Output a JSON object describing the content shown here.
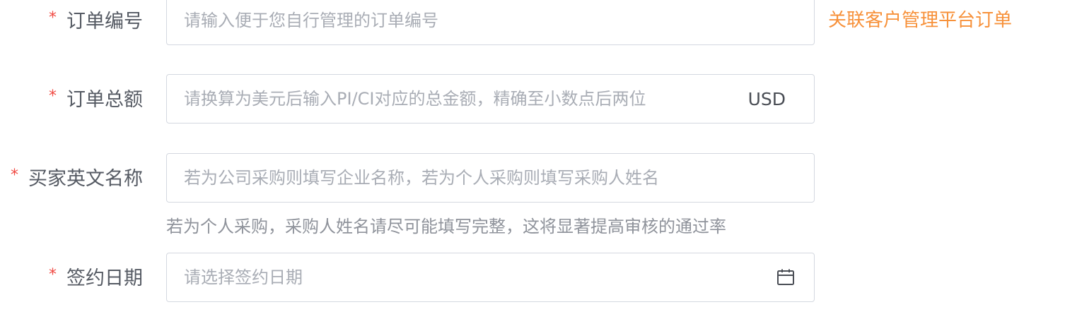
{
  "form": {
    "required_mark": "*",
    "order_number": {
      "label": "订单编号",
      "placeholder": "请输入便于您自行管理的订单编号",
      "link": "关联客户管理平台订单"
    },
    "order_total": {
      "label": "订单总额",
      "placeholder": "请换算为美元后输入PI/CI对应的总金额，精确至小数点后两位",
      "suffix": "USD"
    },
    "buyer_name": {
      "label": "买家英文名称",
      "placeholder": "若为公司采购则填写企业名称，若为个人采购则填写采购人姓名",
      "hint": "若为个人采购，采购人姓名请尽可能填写完整，这将显著提高审核的通过率"
    },
    "sign_date": {
      "label": "签约日期",
      "placeholder": "请选择签约日期",
      "icon": "calendar-icon"
    }
  },
  "colors": {
    "required": "#f04a43",
    "link": "#f7913a",
    "border": "#d4d8e0",
    "placeholder": "#a9adb5",
    "label": "#555a63",
    "hint": "#8f939b"
  }
}
